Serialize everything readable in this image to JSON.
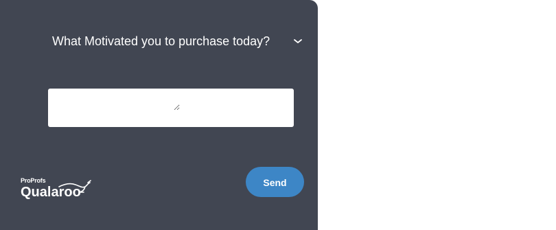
{
  "survey": {
    "question": "What Motivated you to purchase today?",
    "answer_value": "",
    "send_label": "Send"
  },
  "brand": {
    "parent": "ProProfs",
    "name": "Qualaroo"
  },
  "icons": {
    "minimize": "chevron-down-icon",
    "logo": "kangaroo-logo-icon"
  },
  "colors": {
    "panel_background": "#414652",
    "send_button": "#3d86c6"
  }
}
